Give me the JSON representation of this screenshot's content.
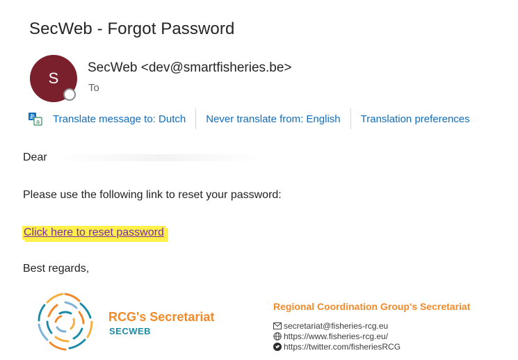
{
  "email": {
    "subject": "SecWeb - Forgot Password",
    "avatar_initial": "S",
    "sender": "SecWeb <dev@smartfisheries.be>",
    "to_label": "To"
  },
  "translation_bar": {
    "translate_label": "Translate message to: Dutch",
    "never_translate_label": "Never translate from: English",
    "preferences_label": "Translation preferences"
  },
  "message": {
    "greeting": "Dear",
    "instruction": "Please use the following link to reset your password:",
    "reset_link": "Click here to reset password",
    "closing": "Best regards,"
  },
  "signature": {
    "logo_title": "RCG's Secretariat",
    "logo_subtitle": "SECWEB",
    "group_title": "Regional Coordination Group's Secretariat",
    "email": "secretariat@fisheries-rcg.eu",
    "website": "https://www.fisheries-rcg.eu/",
    "twitter": "https://twitter.com/fisheriesRCG"
  },
  "colors": {
    "avatar_bg": "#7a1f2c",
    "link_blue": "#0f6cbd",
    "highlight_yellow": "#fff04a",
    "brand_orange": "#f08a2a",
    "brand_teal": "#1c8ba6"
  }
}
